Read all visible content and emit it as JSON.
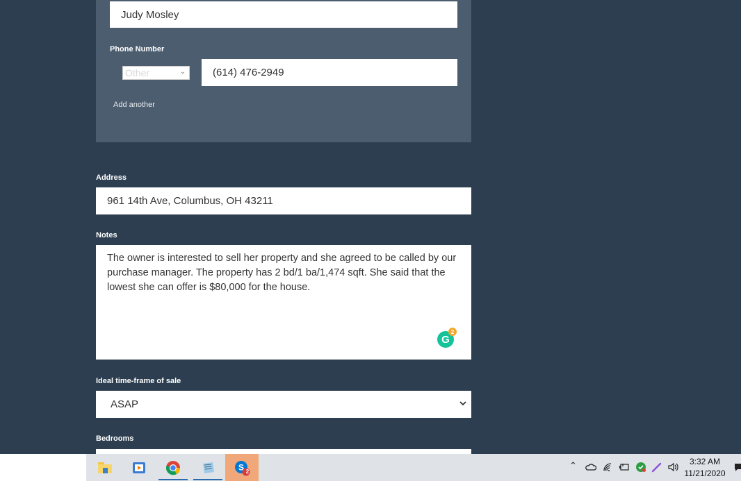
{
  "contact": {
    "name_value": "Judy Mosley",
    "phone_label": "Phone Number",
    "phone_type_selected": "Other",
    "phone_value": "(614) 476-2949",
    "add_another_label": "Add another"
  },
  "address": {
    "label": "Address",
    "value": "961 14th Ave, Columbus, OH 43211"
  },
  "notes": {
    "label": "Notes",
    "value": "The owner is interested to sell her property and she agreed to be called by our purchase manager. The property has 2 bd/1 ba/1,474 sqft. She said that the lowest she can offer is $80,000 for the house.",
    "grammarly_count": "2"
  },
  "timeframe": {
    "label": "Ideal time-frame of sale",
    "selected": "ASAP"
  },
  "bedrooms": {
    "label": "Bedrooms"
  },
  "taskbar": {
    "apps": [
      {
        "icon": "file-explorer-icon"
      },
      {
        "icon": "media-player-icon"
      },
      {
        "icon": "chrome-icon"
      },
      {
        "icon": "notepad-icon"
      },
      {
        "icon": "skype-icon",
        "badge": "2"
      }
    ],
    "clock_time": "3:32 AM",
    "clock_date": "11/21/2020"
  },
  "colors": {
    "page_background": "#2c3e50",
    "card_background": "#4b5d6f",
    "grammarly": "#15c39a",
    "active_taskbar": "#f0a779"
  }
}
